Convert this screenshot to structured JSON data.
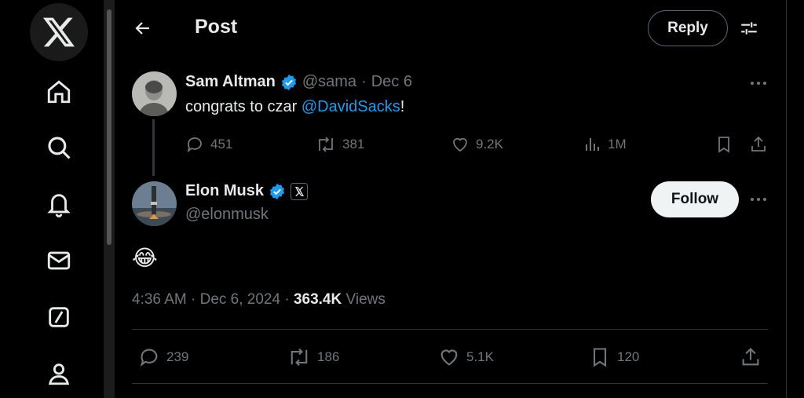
{
  "nav": {
    "items": [
      "x-logo",
      "home",
      "explore",
      "notifications",
      "messages",
      "grok",
      "profile"
    ]
  },
  "header": {
    "title": "Post",
    "reply_label": "Reply"
  },
  "quoted_post": {
    "author_name": "Sam Altman",
    "handle": "@sama",
    "separator": "·",
    "date": "Dec 6",
    "text_prefix": "congrats to czar ",
    "mention": "@DavidSacks",
    "text_suffix": "!",
    "stats": {
      "replies": "451",
      "reposts": "381",
      "likes": "9.2K",
      "views": "1M"
    }
  },
  "main_post": {
    "author_name": "Elon Musk",
    "handle": "@elonmusk",
    "follow_label": "Follow",
    "emoji": "😂",
    "time": "4:36 AM · Dec 6, 2024 · ",
    "views_count": "363.4K",
    "views_label": " Views",
    "stats": {
      "replies": "239",
      "reposts": "186",
      "likes": "5.1K",
      "bookmarks": "120"
    }
  },
  "colors": {
    "accent": "#1d9bf0",
    "muted": "#71767b",
    "background": "#000000",
    "border": "#2f3336"
  }
}
